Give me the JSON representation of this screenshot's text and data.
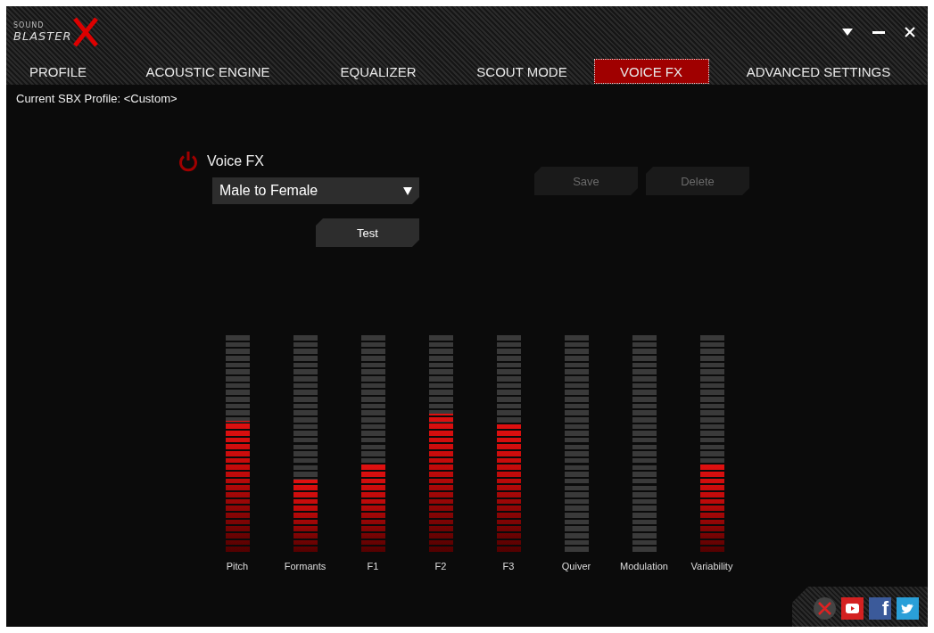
{
  "logo": {
    "small": "SOUND",
    "main": "BLASTER"
  },
  "tabs": [
    {
      "label": "PROFILE",
      "selected": false
    },
    {
      "label": "ACOUSTIC ENGINE",
      "selected": false
    },
    {
      "label": "EQUALIZER",
      "selected": false
    },
    {
      "label": "SCOUT MODE",
      "selected": false
    },
    {
      "label": "VOICE FX",
      "selected": true
    },
    {
      "label": "ADVANCED SETTINGS",
      "selected": false
    }
  ],
  "profile": "Current SBX Profile: <Custom>",
  "voice_fx": {
    "on": true,
    "label": "Voice FX",
    "preset": "Male to Female",
    "test": "Test"
  },
  "buttons": [
    {
      "label": "Save",
      "disabled": true
    },
    {
      "label": "Delete",
      "disabled": true
    }
  ],
  "meters": [
    {
      "label": "Pitch",
      "level": 0.61
    },
    {
      "label": "Formants",
      "level": 0.34
    },
    {
      "label": "F1",
      "level": 0.41
    },
    {
      "label": "F2",
      "level": 0.64
    },
    {
      "label": "F3",
      "level": 0.59
    },
    {
      "label": "Quiver",
      "level": 0
    },
    {
      "label": "Modulation",
      "level": 0
    },
    {
      "label": "Variability",
      "level": 0.41
    }
  ],
  "social": [
    {
      "kind": "close"
    },
    {
      "kind": "youtube"
    },
    {
      "kind": "facebook",
      "glyph": "f"
    },
    {
      "kind": "twitter"
    }
  ]
}
